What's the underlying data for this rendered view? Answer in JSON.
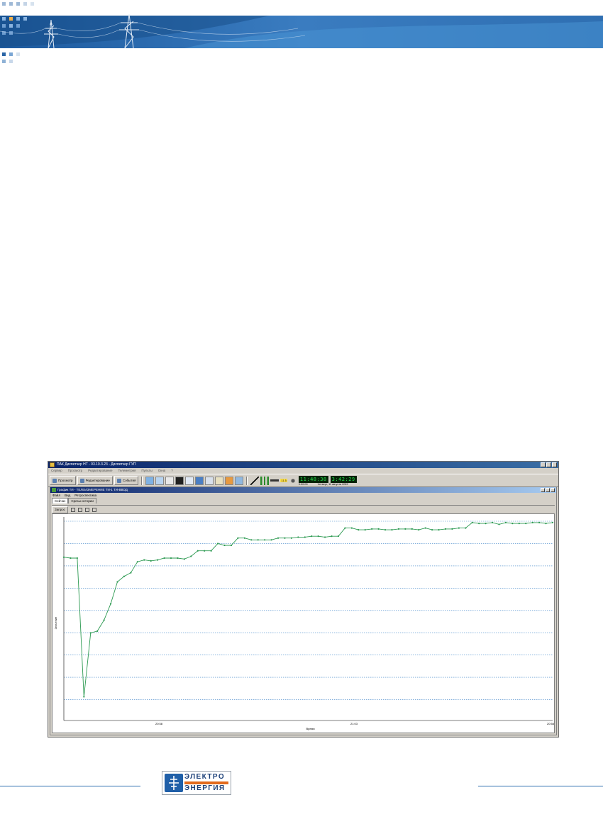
{
  "colors": {
    "banner_blue": "#2e6faf",
    "series": "#2d9a52",
    "grid": "#3e83c8",
    "lcd_text": "#26e04a"
  },
  "app": {
    "title": "ПАК Диспетчер НТ - 03.10.3.23 - Диспетчер ГУП",
    "menu": [
      "Сервер",
      "Просмотр",
      "Редактирование",
      "Телеметрия",
      "Пульты",
      "Окна",
      "?"
    ],
    "toolbar": {
      "view_button": "Просмотр",
      "edit_button": "Редактирование",
      "events_button": "События"
    },
    "indicator": "11.5",
    "lcd_time": "11:48:38",
    "lcd_value": "3:42:29",
    "lcd_sub_left": "0:00:00",
    "lcd_sub_right": "Четверг, 11 августа 2022"
  },
  "child": {
    "title": "График ТИ - ТЕЛЕИЗМЕРЕНИЕ ТИ-1 ТИ-ВВОД",
    "menu": [
      "Файл",
      "Вид",
      "Ретроспектива"
    ],
    "tabs": [
      "Сейчас",
      "Срезы истории"
    ],
    "toolbar": {
      "request_button": "Запрос"
    }
  },
  "chart_data": {
    "type": "line",
    "ylabel": "Значение",
    "xlabel": "Время",
    "x_tick_labels": [
      "20:58",
      "21:03",
      "20:58"
    ],
    "grid": "horizontal dotted",
    "series": [
      {
        "values": [
          239.5,
          239,
          239,
          163,
          198,
          199,
          205,
          214,
          226,
          229,
          231,
          237,
          238,
          237.5,
          238,
          239,
          239,
          239,
          238.5,
          240,
          243,
          243,
          243,
          247,
          246,
          246,
          250,
          250,
          249,
          249,
          249,
          249,
          250,
          250,
          250,
          250.5,
          250.5,
          251,
          251,
          250.5,
          251,
          251,
          255.5,
          255.5,
          254.5,
          254.5,
          255,
          255,
          254.5,
          254.5,
          255,
          255,
          255,
          254.5,
          255.5,
          254.5,
          254.5,
          255,
          255,
          255.5,
          255.5,
          258.5,
          258,
          258,
          258.5,
          257.5,
          258.5,
          258,
          258,
          258,
          258.5,
          258.5,
          258,
          258.5
        ]
      }
    ]
  },
  "footer": {
    "logo_line1": "ЭЛЕКТРО",
    "logo_line2": "ЭНЕРГИЯ"
  }
}
